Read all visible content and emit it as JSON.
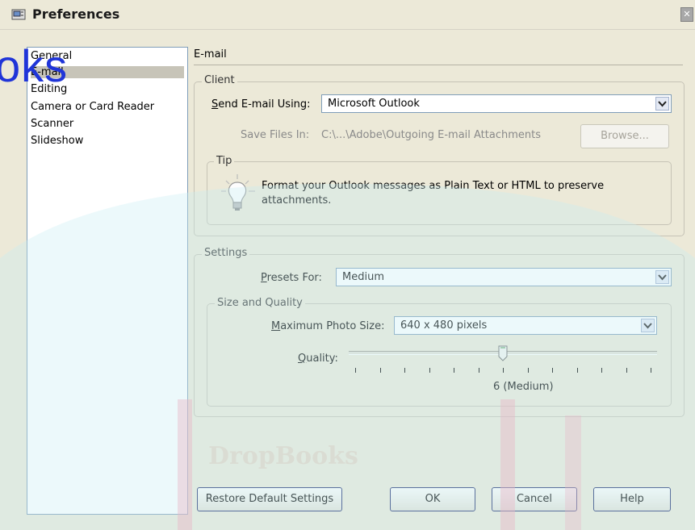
{
  "window": {
    "title": "Preferences",
    "close_glyph": "✕"
  },
  "sidebar": {
    "items": [
      {
        "label": "General"
      },
      {
        "label": "E-mail"
      },
      {
        "label": "Editing"
      },
      {
        "label": "Camera or Card Reader"
      },
      {
        "label": "Scanner"
      },
      {
        "label": "Slideshow"
      }
    ],
    "selected": "E-mail"
  },
  "main": {
    "heading": "E-mail",
    "client": {
      "legend": "Client",
      "send_label": "Send E-mail Using:",
      "send_value": "Microsoft Outlook",
      "save_label": "Save Files In:",
      "save_path": "C:\\...\\Adobe\\Outgoing E-mail Attachments",
      "browse_label": "Browse...",
      "tip": {
        "legend": "Tip",
        "text": "Format your Outlook messages as Plain Text or HTML to preserve attachments."
      }
    },
    "settings": {
      "legend": "Settings",
      "presets_label": "Presets For:",
      "presets_value": "Medium",
      "size_quality": {
        "legend": "Size and Quality",
        "max_size_label": "Maximum Photo Size:",
        "max_size_value": "640 x 480 pixels",
        "quality_label": "Quality:",
        "quality_value": 6,
        "quality_max": 12,
        "quality_readout": "6 (Medium)"
      }
    }
  },
  "footer": {
    "restore_label": "Restore Default Settings",
    "ok_label": "OK",
    "cancel_label": "Cancel",
    "help_label": "Help"
  },
  "overlay": {
    "blue_text": "oks",
    "faded_text": "DropBooks"
  },
  "colors": {
    "dialog_bg": "#ece9d8",
    "border_blue": "#7f9db9",
    "overlay_blue": "#2035d8",
    "watermark_cyan": "#c8eef3",
    "watermark_pink": "#e8b8c8"
  }
}
